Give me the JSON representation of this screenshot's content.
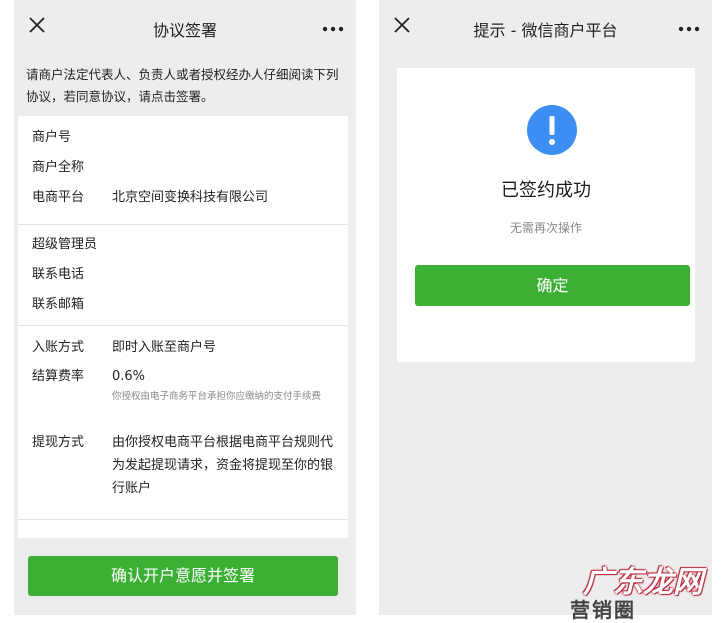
{
  "left": {
    "title": "协议签署",
    "intro": "请商户法定代表人、负责人或者授权经办人仔细阅读下列协议，若同意协议，请点击签署。",
    "group1": [
      {
        "key": "商户号",
        "value": ""
      },
      {
        "key": "商户全称",
        "value": ""
      },
      {
        "key": "电商平台",
        "value": "北京空间变换科技有限公司"
      }
    ],
    "group2": [
      {
        "key": "超级管理员",
        "value": ""
      },
      {
        "key": "联系电话",
        "value": ""
      },
      {
        "key": "联系邮箱",
        "value": ""
      }
    ],
    "group3": {
      "deposit": {
        "key": "入账方式",
        "value": "即时入账至商户号"
      },
      "rate": {
        "key": "结算费率",
        "value": "0.6%",
        "note": "你授权由电子商务平台承担你应缴纳的支付手续费"
      },
      "withdraw": {
        "key": "提现方式",
        "value": "由你授权电商平台根据电商平台规则代为发起提现请求，资金将提现至你的银行账户"
      }
    },
    "confirm_label": "确认开户意愿并签署"
  },
  "right": {
    "title": "提示 - 微信商户平台",
    "icon": "info-icon",
    "headline": "已签约成功",
    "subtext": "无需再次操作",
    "ok_label": "确定"
  },
  "watermark": {
    "site": "广东龙网",
    "bottom_text": "营销圈"
  },
  "colors": {
    "green": "#3cb035",
    "info_blue": "#3d8ef2",
    "background": "#ededed"
  }
}
